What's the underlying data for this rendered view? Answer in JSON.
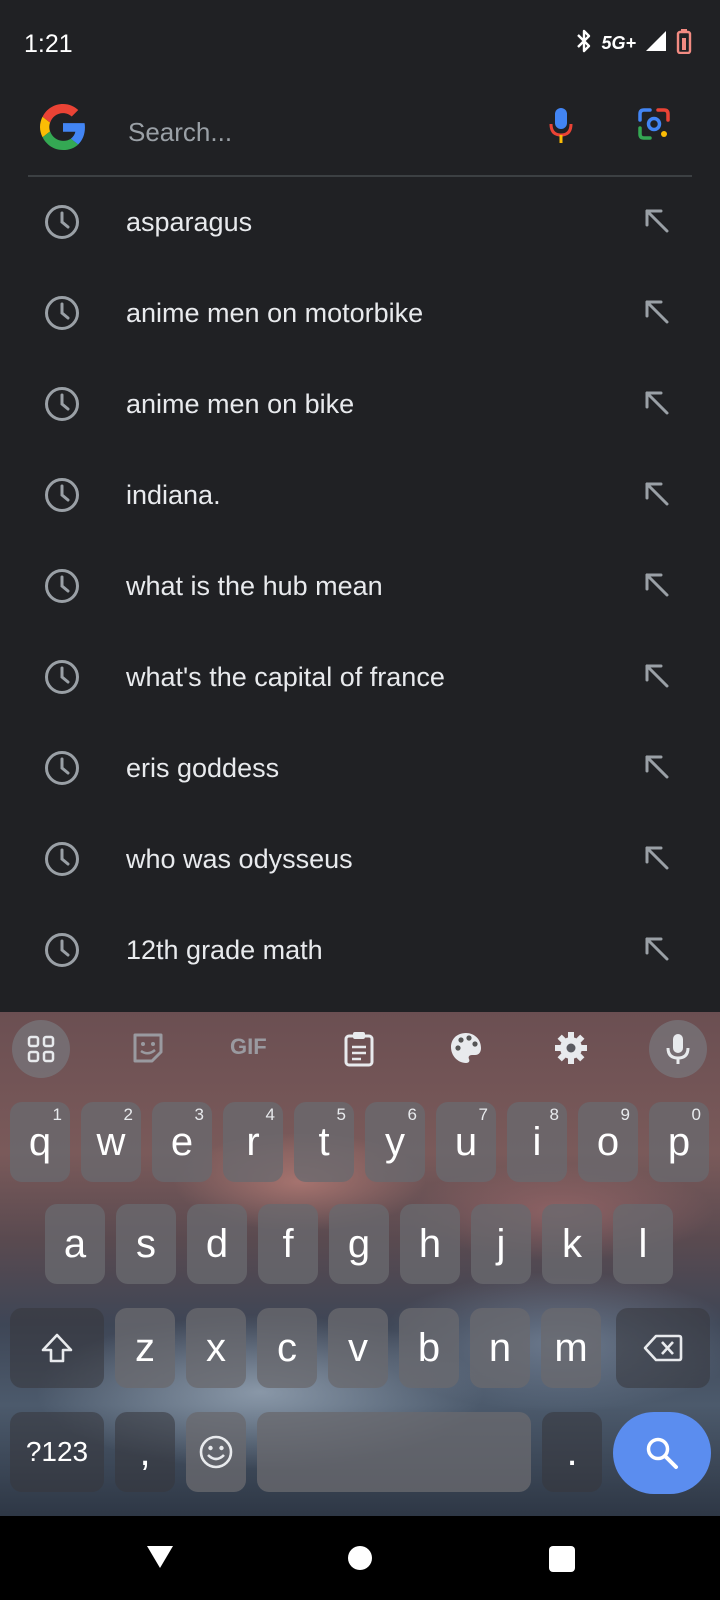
{
  "status_bar": {
    "time": "1:21",
    "network": "5G+"
  },
  "search": {
    "placeholder": "Search..."
  },
  "suggestions": [
    "asparagus",
    "anime men on motorbike",
    "anime men on bike",
    "indiana.",
    "what is the hub mean",
    "what's the capital of france",
    "eris goddess",
    "who was odysseus",
    "12th grade math"
  ],
  "keyboard": {
    "toolbar": {
      "gif_label": "GIF"
    },
    "row1": [
      {
        "letter": "q",
        "num": "1"
      },
      {
        "letter": "w",
        "num": "2"
      },
      {
        "letter": "e",
        "num": "3"
      },
      {
        "letter": "r",
        "num": "4"
      },
      {
        "letter": "t",
        "num": "5"
      },
      {
        "letter": "y",
        "num": "6"
      },
      {
        "letter": "u",
        "num": "7"
      },
      {
        "letter": "i",
        "num": "8"
      },
      {
        "letter": "o",
        "num": "9"
      },
      {
        "letter": "p",
        "num": "0"
      }
    ],
    "row2": [
      "a",
      "s",
      "d",
      "f",
      "g",
      "h",
      "j",
      "k",
      "l"
    ],
    "row3": [
      "z",
      "x",
      "c",
      "v",
      "b",
      "n",
      "m"
    ],
    "symbols_label": "?123",
    "comma_label": ",",
    "period_label": "."
  },
  "colors": {
    "background": "#202124",
    "text": "#e8eaed",
    "search_key": "#5b8def",
    "battery": "#f28b82"
  }
}
